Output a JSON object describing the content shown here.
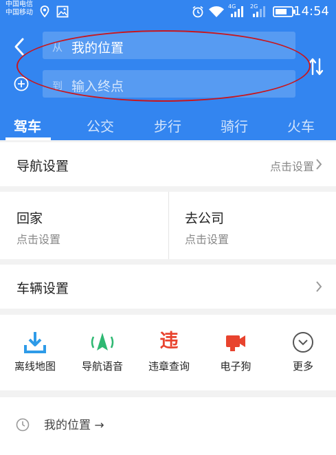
{
  "status_bar": {
    "carrier_1": "中国电信",
    "carrier_2": "中国移动",
    "net_1": "4G",
    "net_2": "2G",
    "time": "14:54"
  },
  "route": {
    "from_tag": "从",
    "from_value": "我的位置",
    "to_tag": "到",
    "to_placeholder": "输入终点"
  },
  "tabs": [
    "驾车",
    "公交",
    "步行",
    "骑行",
    "火车"
  ],
  "active_tab": "驾车",
  "nav_settings": {
    "title": "导航设置",
    "hint": "点击设置"
  },
  "home": {
    "title": "回家",
    "hint": "点击设置"
  },
  "work": {
    "title": "去公司",
    "hint": "点击设置"
  },
  "vehicle": {
    "title": "车辆设置"
  },
  "quick_actions": [
    {
      "label": "离线地图",
      "icon": "download-icon"
    },
    {
      "label": "导航语音",
      "icon": "navigation-voice-icon"
    },
    {
      "label": "违章查询",
      "icon": "violation-icon",
      "glyph": "违"
    },
    {
      "label": "电子狗",
      "icon": "camera-icon"
    },
    {
      "label": "更多",
      "icon": "more-chevron-icon"
    }
  ],
  "history": {
    "text": "我的位置 →"
  },
  "colors": {
    "header_blue": "#3385f0",
    "annotation_red": "#c8161d",
    "download_blue": "#2e9be8",
    "voice_green": "#2eb872",
    "violation_red": "#e8432e",
    "camera_red": "#e8432e"
  }
}
